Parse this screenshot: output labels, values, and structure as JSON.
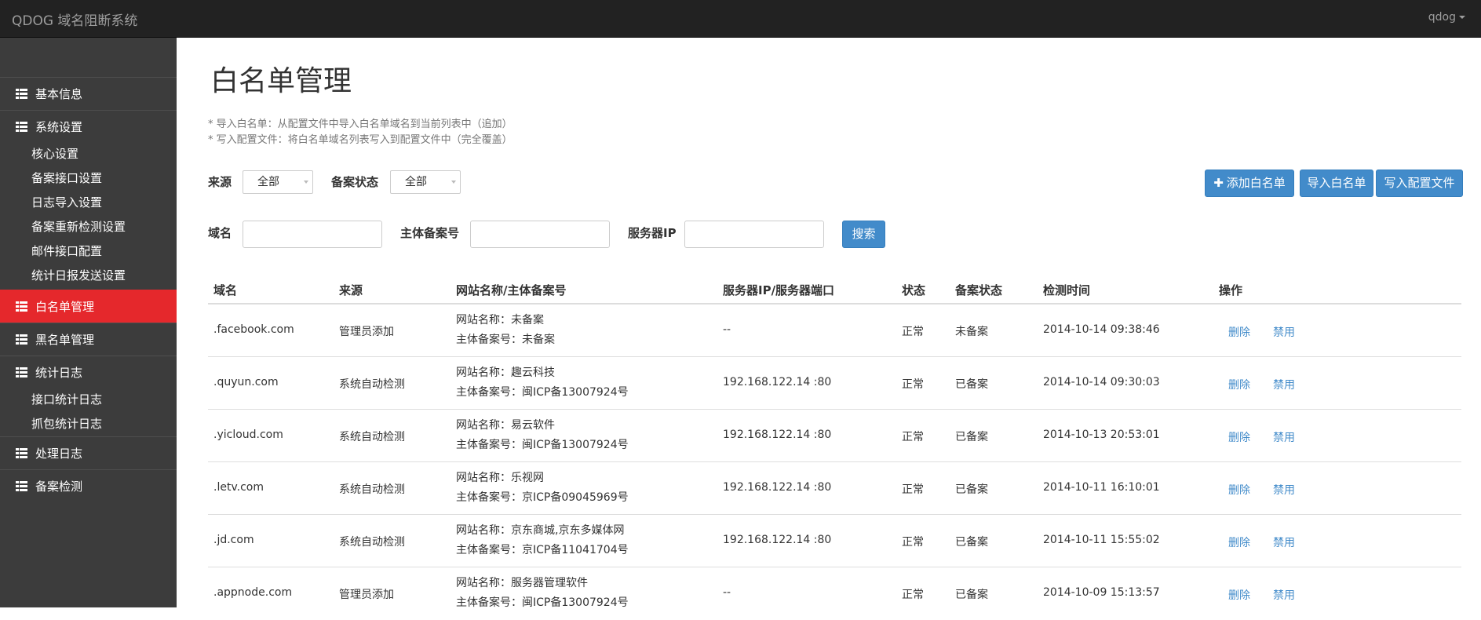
{
  "app": {
    "title": "QDOG 域名阻断系统",
    "user": "qdog"
  },
  "sidebar": {
    "basic_info": "基本信息",
    "system_settings": "系统设置",
    "sub_settings": [
      "核心设置",
      "备案接口设置",
      "日志导入设置",
      "备案重新检测设置",
      "邮件接口配置",
      "统计日报发送设置"
    ],
    "whitelist": "白名单管理",
    "blacklist": "黑名单管理",
    "stats_log": "统计日志",
    "sub_stats": [
      "接口统计日志",
      "抓包统计日志"
    ],
    "process_log": "处理日志",
    "record_check": "备案检测"
  },
  "page": {
    "title": "白名单管理",
    "notes": [
      "* 导入白名单：从配置文件中导入白名单域名到当前列表中（追加）",
      "* 写入配置文件：将白名单域名列表写入到配置文件中（完全覆盖）"
    ]
  },
  "filters": {
    "source_label": "来源",
    "source_value": "全部",
    "record_status_label": "备案状态",
    "record_status_value": "全部",
    "domain_label": "域名",
    "domain_value": "",
    "icp_label": "主体备案号",
    "icp_value": "",
    "server_ip_label": "服务器IP",
    "server_ip_value": "",
    "search_button": "搜索"
  },
  "actions": {
    "add_whitelist": "添加白名单",
    "import_whitelist": "导入白名单",
    "write_config": "写入配置文件"
  },
  "table": {
    "headers": [
      "域名",
      "来源",
      "网站名称/主体备案号",
      "服务器IP/服务器端口",
      "状态",
      "备案状态",
      "检测时间",
      "操作"
    ],
    "rows": [
      {
        "domain": ".facebook.com",
        "source": "管理员添加",
        "site_name": "网站名称：未备案",
        "icp": "主体备案号：未备案",
        "server": "--",
        "status": "正常",
        "record_status": "未备案",
        "time": "2014-10-14 09:38:46",
        "delete": "删除",
        "disable": "禁用"
      },
      {
        "domain": ".quyun.com",
        "source": "系统自动检测",
        "site_name": "网站名称：趣云科技",
        "icp": "主体备案号：闽ICP备13007924号",
        "server": "192.168.122.14 :80",
        "status": "正常",
        "record_status": "已备案",
        "time": "2014-10-14 09:30:03",
        "delete": "删除",
        "disable": "禁用"
      },
      {
        "domain": ".yicloud.com",
        "source": "系统自动检测",
        "site_name": "网站名称：易云软件",
        "icp": "主体备案号：闽ICP备13007924号",
        "server": "192.168.122.14 :80",
        "status": "正常",
        "record_status": "已备案",
        "time": "2014-10-13 20:53:01",
        "delete": "删除",
        "disable": "禁用"
      },
      {
        "domain": ".letv.com",
        "source": "系统自动检测",
        "site_name": "网站名称：乐视网",
        "icp": "主体备案号：京ICP备09045969号",
        "server": "192.168.122.14 :80",
        "status": "正常",
        "record_status": "已备案",
        "time": "2014-10-11 16:10:01",
        "delete": "删除",
        "disable": "禁用"
      },
      {
        "domain": ".jd.com",
        "source": "系统自动检测",
        "site_name": "网站名称：京东商城,京东多媒体网",
        "icp": "主体备案号：京ICP备11041704号",
        "server": "192.168.122.14 :80",
        "status": "正常",
        "record_status": "已备案",
        "time": "2014-10-11 15:55:02",
        "delete": "删除",
        "disable": "禁用"
      },
      {
        "domain": ".appnode.com",
        "source": "管理员添加",
        "site_name": "网站名称：服务器管理软件",
        "icp": "主体备案号：闽ICP备13007924号",
        "server": "--",
        "status": "正常",
        "record_status": "已备案",
        "time": "2014-10-09 15:13:57",
        "delete": "删除",
        "disable": "禁用"
      }
    ]
  }
}
